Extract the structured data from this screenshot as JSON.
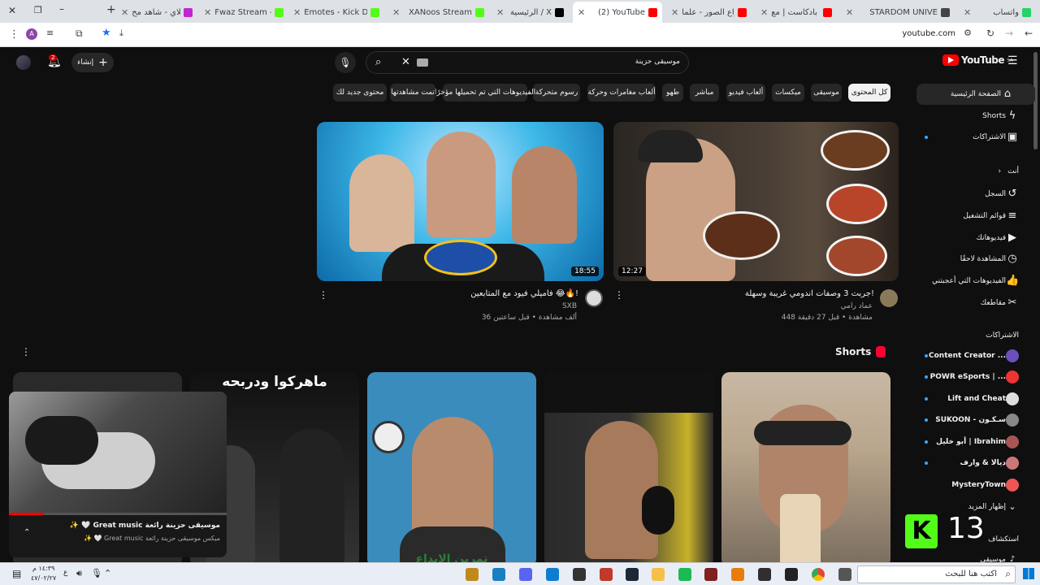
{
  "browser": {
    "tabs": [
      {
        "label": "واتساب",
        "color": "#25d366"
      },
      {
        "label": "STARDOM UNIVE",
        "color": "#444"
      },
      {
        "label": "تلي بادكاست | مع",
        "color": "#ff0000"
      },
      {
        "label": "أنواع الصور - علما",
        "color": "#ff0000"
      },
      {
        "label": "(2) YouTube",
        "color": "#ff0000"
      },
      {
        "label": "الرئيسية / X",
        "color": "#000"
      },
      {
        "label": "XANoos Stream",
        "color": "#53fc18"
      },
      {
        "label": "Emotes - Kick Da",
        "color": "#53fc18"
      },
      {
        "label": "Fwaz Stream - W",
        "color": "#53fc18"
      },
      {
        "label": "تورنلاي - شاهد مح",
        "color": "#c026d3"
      }
    ],
    "new_tab": "+",
    "address": "youtube.com"
  },
  "youtube": {
    "logo_text": "YouTube",
    "logo_region": "SA",
    "search_value": "موسيقى حزينة",
    "create_label": "إنشاء",
    "notification_count": "2",
    "chips": [
      {
        "label": "كل المحتوى",
        "selected": true
      },
      {
        "label": "موسيقى"
      },
      {
        "label": "ميكسات"
      },
      {
        "label": "ألعاب فيديو"
      },
      {
        "label": "مباشر"
      },
      {
        "label": "طهو"
      },
      {
        "label": "ألعاب مغامرات وحركة"
      },
      {
        "label": "رسوم متحركة"
      },
      {
        "label": "الفيديوهات التي تم تحميلها مؤخرًا"
      },
      {
        "label": "تمت مشاهدتها"
      },
      {
        "label": "محتوى جديد لك"
      }
    ],
    "sidebar": {
      "main": [
        {
          "label": "الصفحة الرئيسية",
          "icon": "home-icon",
          "glyph": "⌂"
        },
        {
          "label": "Shorts",
          "icon": "shorts-icon",
          "glyph": "ϟ"
        },
        {
          "label": "الاشتراكات",
          "icon": "subscriptions-icon",
          "glyph": "▣"
        }
      ],
      "you_header": "أنت",
      "you": [
        {
          "label": "السجل",
          "icon": "history-icon",
          "glyph": "↺"
        },
        {
          "label": "قوائم التشغيل",
          "icon": "playlists-icon",
          "glyph": "≡"
        },
        {
          "label": "فيديوهاتك",
          "icon": "your-videos-icon",
          "glyph": "▶"
        },
        {
          "label": "المشاهدة لاحقًا",
          "icon": "watch-later-icon",
          "glyph": "◷"
        },
        {
          "label": "الفيديوهات التي أعجبتني",
          "icon": "liked-icon",
          "glyph": "👍"
        },
        {
          "label": "مقاطعك",
          "icon": "clips-icon",
          "glyph": "✂"
        }
      ],
      "subs_header": "الاشتراكات",
      "subscriptions": [
        {
          "label": "Content Creator ...",
          "color": "#6b4fbb"
        },
        {
          "label": "POWR eSports | ...",
          "color": "#e33"
        },
        {
          "label": "Lift and Cheat",
          "color": "#ddd"
        },
        {
          "label": "SUKOON - سـكـون",
          "color": "#888"
        },
        {
          "label": "أبو خليل | Ibrahim",
          "color": "#a55"
        },
        {
          "label": "ديالا & وارف",
          "color": "#c77"
        },
        {
          "label": "MysteryTown",
          "color": "#e55"
        }
      ],
      "show_more": "إظهار المزيد",
      "explore": "استكشاف",
      "music": "موسيقى"
    },
    "videos": [
      {
        "title": "فاميلي فيود مع المتابعين 😂🔥!",
        "channel": "SXB",
        "meta": "36 ألف مشاهدة • قبل ساعتين",
        "duration": "18:55"
      },
      {
        "title": "جربت 3 وصفات اندومي غريبة وسهلة!",
        "channel": "عماد رامي",
        "meta": "448 مشاهدة • قبل 27 دقيقة",
        "duration": "12:27"
      }
    ],
    "shorts_header": "Shorts",
    "shorts": [
      {
        "caption": "ماهركوا ودربحه"
      },
      {
        "caption": "تمرين الإبداع"
      }
    ],
    "miniplayer": {
      "title": "موسيقى حزينة رائعة Great music 🤍 ✨",
      "subtitle": "ميكس موسيقى حزينة رائعة Great music 🤍 ✨"
    },
    "kick_overlay": "13"
  },
  "taskbar": {
    "search_placeholder": "اكتب هنا للبحث",
    "time": "١٤:٣٩ م",
    "date": "٤٧/٠٢/٢٧"
  }
}
